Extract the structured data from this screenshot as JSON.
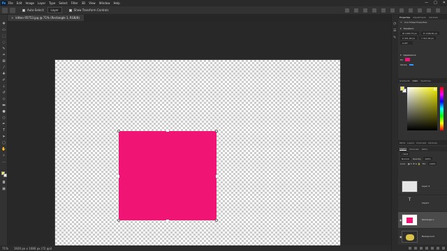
{
  "app": {
    "logo": "Ps"
  },
  "menu": [
    "File",
    "Edit",
    "Image",
    "Layer",
    "Type",
    "Select",
    "Filter",
    "3D",
    "View",
    "Window",
    "Help"
  ],
  "window_controls": [
    "—",
    "□",
    "✕"
  ],
  "options": {
    "auto_select": "Auto-Select:",
    "select_value": "Layer",
    "show_transform": "Show Transform Controls"
  },
  "document": {
    "tab_title": "kitten 95753.jpg @ 71% (Rectangle 1, RGB/8)",
    "close": "×"
  },
  "status": {
    "zoom": "71%",
    "doc_size": "1920 px x 1080 px (72 ppi)"
  },
  "properties": {
    "tabs": [
      "Properties",
      "Adjustments",
      "Libraries"
    ],
    "layer_kind": "Live Shape Properties",
    "transform_label": "Transform",
    "w": "W  1000.73 px",
    "h": "H  1196.81 px",
    "x": "X  431.04 px",
    "y": "Y  311.04 px",
    "angle": "0.00°",
    "appearance_label": "Appearance",
    "fill": "Fill",
    "stroke": "Stroke"
  },
  "color_panel": {
    "tabs": [
      "Gradients",
      "Color",
      "Swatches"
    ],
    "fg": "#f5eb4a",
    "bg": "#ffffff"
  },
  "layers_panel": {
    "top_tabs": [
      "Paths",
      "Layers",
      "Channels",
      "Libraries"
    ],
    "tabs": [
      "Layers",
      "Channels",
      "Paths"
    ],
    "kind": "Kind",
    "blend_mode": "Normal",
    "opacity_label": "Opacity:",
    "opacity_value": "100%",
    "lock_label": "Lock:",
    "fill_label": "Fill:",
    "fill_value": "100%",
    "layers": [
      {
        "name": "Layer 2",
        "visible": false
      },
      {
        "name": "Layers",
        "visible": false
      },
      {
        "name": "Rectangle 1",
        "visible": true
      },
      {
        "name": "Background",
        "visible": true
      }
    ]
  },
  "colors": {
    "accent_pink": "#f01474",
    "ui_dark": "#323232"
  }
}
